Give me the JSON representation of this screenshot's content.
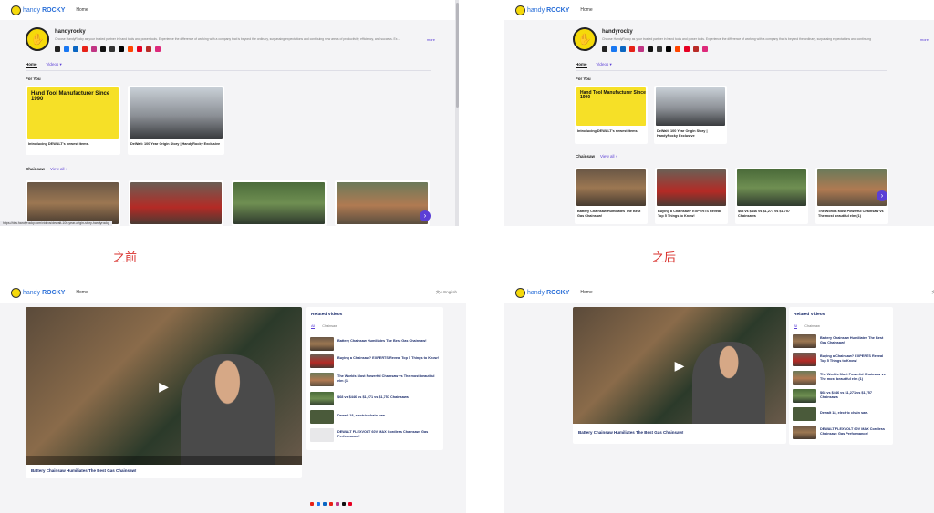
{
  "app": {
    "logo_handy": "handy",
    "logo_rocky": "ROCKY",
    "home": "Home",
    "language": "English"
  },
  "captions": {
    "before": "之前",
    "after": "之后"
  },
  "channel": {
    "name": "handyrocky",
    "description": "Choose HandyRocky as your trusted partner in hand tools and power tools. Experience the difference of working with a company that is beyond the ordinary, surpassing expectations and continuing new areas of productivity, efficiency, and success. Ex...",
    "more": "more",
    "tab_home": "Home",
    "tab_videos": "Videos",
    "socials": [
      {
        "icon": "home-icon",
        "color": "#222222"
      },
      {
        "icon": "facebook-icon",
        "color": "#1877f2"
      },
      {
        "icon": "linkedin-icon",
        "color": "#0a66c2"
      },
      {
        "icon": "youtube-icon",
        "color": "#e62117"
      },
      {
        "icon": "instagram-icon",
        "color": "#c13584"
      },
      {
        "icon": "tiktok-icon",
        "color": "#111111"
      },
      {
        "icon": "threads-icon",
        "color": "#333333"
      },
      {
        "icon": "x-icon",
        "color": "#000000"
      },
      {
        "icon": "reddit-icon",
        "color": "#ff4500"
      },
      {
        "icon": "pinterest-icon",
        "color": "#e60023"
      },
      {
        "icon": "quora-icon",
        "color": "#b92b27"
      },
      {
        "icon": "instagram-icon",
        "color": "#dd2a7b"
      }
    ]
  },
  "for_you": {
    "title": "For You",
    "cards": [
      {
        "title": "Introducing DEWALT's newest items.",
        "thumb_text": "Hand Tool Manufacturer Since 1990"
      },
      {
        "title": "DeWalt: 100 Year Origin Story | HandyRocky Exclusive"
      }
    ]
  },
  "chainsaw": {
    "title": "Chainsaw",
    "view_all": "View all",
    "cards": [
      {
        "title": "Battery Chainsaw Humiliates The Best Gas Chainsaw!"
      },
      {
        "title": "Buying a Chainsaw? EXPERTS Reveal Top 5 Things to Know!"
      },
      {
        "title": "$68 vs $446 vs $1,271 vs $1,757 Chainsaws"
      },
      {
        "title": "The Worlds Most Powerful Chainsaw vs The most beautiful elm (1)"
      }
    ]
  },
  "status_url": "https://dev.handyrocky.com/videos/dewalt-100-year-origin-story-handyrocky",
  "video_page": {
    "video_title": "Battery Chainsaw Humiliates The Best Gas Chainsaw!",
    "related_title": "Related Videos",
    "tab_all": "All",
    "tab_chainsaw": "Chainsaw",
    "before_related": [
      "Battery Chainsaw Humiliates The Best Gas Chainsaw!",
      "Buying a Chainsaw? EXPERTS Reveal Top 5 Things to Know!",
      "The Worlds Most Powerful Chainsaw vs The most beautiful elm (1)",
      "$68 vs $446 vs $1,271 vs $1,757 Chainsaws",
      "Dewalt 18, electric chain saw.",
      "DEWALT FLEXVOLT 60V MAX Cordless Chainsaw: Gas Performance!"
    ],
    "after_related": [
      "Battery Chainsaw Humiliates The Best Gas Chainsaw!",
      "Buying a Chainsaw? EXPERTS Reveal Top 5 Things to Know!",
      "The Worlds Most Powerful Chainsaw vs The most beautiful elm (1)",
      "$68 vs $446 vs $1,271 vs $1,757 Chainsaws",
      "Dewalt 18, electric chain saw.",
      "DEWALT FLEXVOLT 60V MAX Cordless Chainsaw: Gas Performance!"
    ]
  }
}
